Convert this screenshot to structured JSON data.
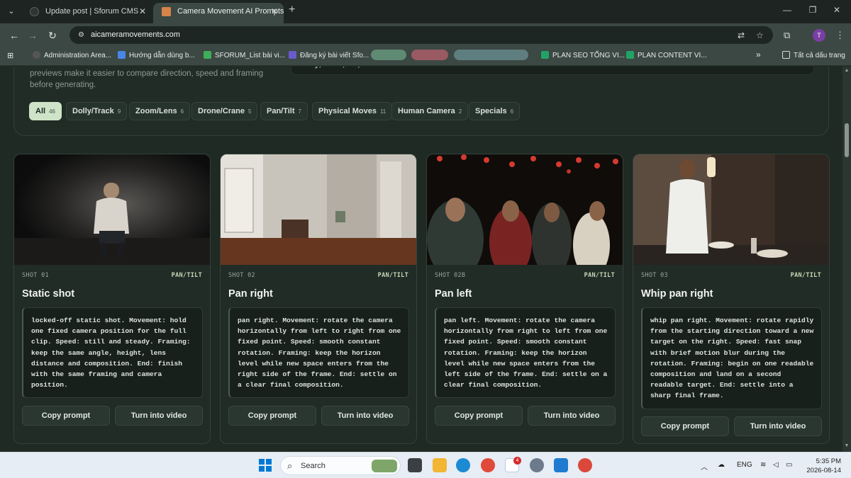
{
  "browser": {
    "tabs": [
      {
        "title": "Update post | Sforum CMS"
      },
      {
        "title": "Camera Movement AI Prompts"
      }
    ],
    "url": "aicameramovements.com",
    "profile_initial": "T",
    "bookmarks": [
      {
        "label": "Administration Area..."
      },
      {
        "label": "Hướng dẫn dùng b..."
      },
      {
        "label": "SFORUM_List bài vi..."
      },
      {
        "label": "Đăng ký bài viết Sfo..."
      },
      {
        "label": "PLAN SEO TỔNG VI..."
      },
      {
        "label": "PLAN CONTENT VI..."
      }
    ],
    "all_bookmarks_label": "Tất cả dấu trang"
  },
  "page": {
    "intro_text": "previews make it easier to compare direction, speed and framing before generating.",
    "search_placeholder": "Dolly, orbit, tilt, drone...",
    "filters": [
      {
        "label": "All",
        "count": "46",
        "active": true
      },
      {
        "label": "Dolly/Track",
        "count": "9"
      },
      {
        "label": "Zoom/Lens",
        "count": "6"
      },
      {
        "label": "Drone/Crane",
        "count": "5"
      },
      {
        "label": "Pan/Tilt",
        "count": "7"
      },
      {
        "label": "Physical Moves",
        "count": "11"
      },
      {
        "label": "Human Camera",
        "count": "2"
      },
      {
        "label": "Specials",
        "count": "6"
      }
    ],
    "cards": [
      {
        "shot": "SHOT 01",
        "category": "PAN/TILT",
        "title": "Static shot",
        "prompt": "locked-off static shot. Movement: hold one fixed camera position for the full clip. Speed: still and steady. Framing: keep the same angle, height, lens distance and composition. End: finish with the same framing and camera position.",
        "copy_label": "Copy prompt",
        "video_label": "Turn into video",
        "image": "man-seated-dark-room"
      },
      {
        "shot": "SHOT 02",
        "category": "PAN/TILT",
        "title": "Pan right",
        "prompt": "pan right. Movement: rotate the camera horizontally from left to right from one fixed point. Speed: smooth constant rotation. Framing: keep the horizon level while new space enters from the right side of the frame. End: settle on a clear final composition.",
        "copy_label": "Copy prompt",
        "video_label": "Turn into video",
        "image": "empty-apartment-interior"
      },
      {
        "shot": "SHOT 02B",
        "category": "PAN/TILT",
        "title": "Pan left",
        "prompt": "pan left. Movement: rotate the camera horizontally from right to left from one fixed point. Speed: smooth constant rotation. Framing: keep the horizon level while new space enters from the left side of the frame. End: settle on a clear final composition.",
        "copy_label": "Copy prompt",
        "video_label": "Turn into video",
        "image": "night-crowd-lanterns"
      },
      {
        "shot": "SHOT 03",
        "category": "PAN/TILT",
        "title": "Whip pan right",
        "prompt": "whip pan right. Movement: rotate rapidly from the starting direction toward a new target on the right. Speed: fast snap with brief motion blur during the rotation. Framing: begin on one readable composition and land on a second readable target. End: settle into a sharp final frame.",
        "copy_label": "Copy prompt",
        "video_label": "Turn into video",
        "image": "chef-in-kitchen"
      }
    ]
  },
  "taskbar": {
    "search_label": "Search",
    "zalo_badge": "4",
    "language": "ENG",
    "time": "5:35 PM",
    "date": "2026-08-14"
  }
}
